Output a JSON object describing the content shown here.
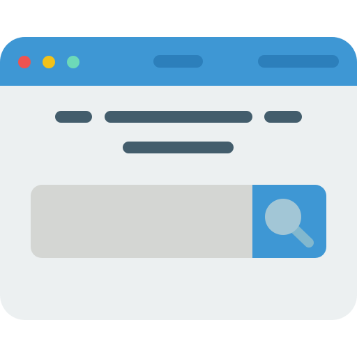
{
  "window": {
    "titlebar_color": "#3e97d4",
    "body_color": "#ecf0f1",
    "controls": [
      {
        "name": "close",
        "color": "#ef5350"
      },
      {
        "name": "minimize",
        "color": "#f2c21a"
      },
      {
        "name": "maximize",
        "color": "#6dd9b8"
      }
    ]
  },
  "search": {
    "value": "",
    "placeholder": "",
    "icon": "search-icon",
    "field_color": "#d4d6d3",
    "button_color": "#3e97d4",
    "icon_lens_color": "#a2c6d6",
    "icon_handle_color": "#82b8ce"
  },
  "text_placeholder_color": "#435d6c"
}
